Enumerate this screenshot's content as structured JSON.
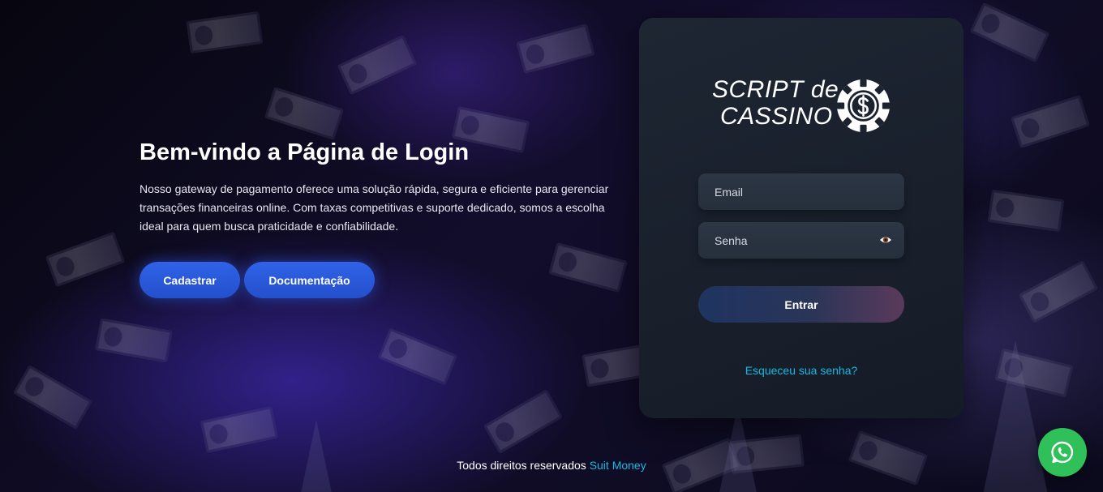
{
  "hero": {
    "title": "Bem-vindo a Página de Login",
    "description": "Nosso gateway de pagamento oferece uma solução rápida, segura e eficiente para gerenciar transações financeiras online. Com taxas competitivas e suporte dedicado, somos a escolha ideal para quem busca praticidade e confiabilidade.",
    "register_label": "Cadastrar",
    "docs_label": "Documentação"
  },
  "login": {
    "logo_line1": "SCRIPT de",
    "logo_line2": "CASSINO",
    "logo_icon": "casino-chip-dollar-icon",
    "email_placeholder": "Email",
    "password_placeholder": "Senha",
    "submit_label": "Entrar",
    "forgot_label": "Esqueceu sua senha?"
  },
  "footer": {
    "text": "Todos direitos reservados",
    "link": "Suit Money"
  },
  "colors": {
    "accent_blue": "#2f63e8",
    "link_cyan": "#1ab8e0",
    "card_bg": "#1b2230",
    "whatsapp_green": "#2fc05a"
  },
  "icons": {
    "password_toggle": "eye-icon",
    "whatsapp": "whatsapp-icon"
  }
}
